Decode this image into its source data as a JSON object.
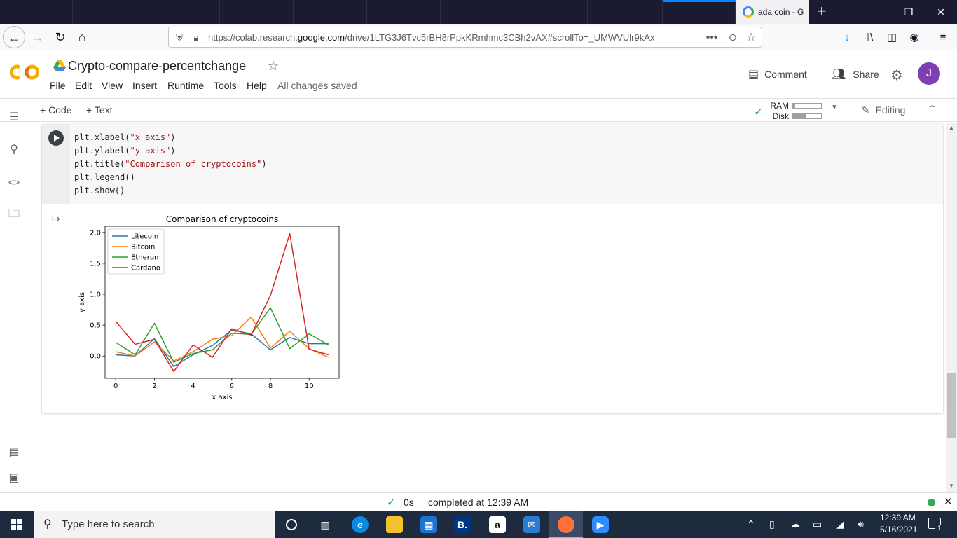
{
  "browser": {
    "active_tab_title": "ada coin - G",
    "url_prefix": "https://colab.research.",
    "url_domain": "google.com",
    "url_path": "/drive/1LTG3J6Tvc5rBH8rPpkKRmhmc3CBh2vAX#scrollTo=_UMWVUlr9kAx",
    "window_controls": {
      "minimize": "—",
      "restore": "❐",
      "close": "✕"
    },
    "new_tab": "+"
  },
  "colab": {
    "logo_text": "CO",
    "doc_title": "Crypto-compare-percentchange",
    "menu": [
      "File",
      "Edit",
      "View",
      "Insert",
      "Runtime",
      "Tools",
      "Help"
    ],
    "save_status": "All changes saved",
    "comment_label": "Comment",
    "share_label": "Share",
    "avatar_letter": "J",
    "toolbar": {
      "add_code": "+ Code",
      "add_text": "+ Text",
      "editing": "Editing"
    },
    "resources": {
      "ram_label": "RAM",
      "disk_label": "Disk",
      "ram_usage": 0.08,
      "disk_usage": 0.45
    }
  },
  "cell": {
    "code_lines": [
      [
        "plt.xlabel(",
        "\"x axis\"",
        ")"
      ],
      [
        "plt.ylabel(",
        "\"y axis\"",
        ")"
      ],
      [
        "plt.title(",
        "\"Comparison of cryptocoins\"",
        ")"
      ],
      [
        "plt.legend()",
        "",
        ""
      ],
      [
        "plt.show()",
        "",
        ""
      ]
    ]
  },
  "chart_data": {
    "type": "line",
    "title": "Comparison of cryptocoins",
    "xlabel": "x axis",
    "ylabel": "y axis",
    "x": [
      0,
      1,
      2,
      3,
      4,
      5,
      6,
      7,
      8,
      9,
      10,
      11
    ],
    "xlim": [
      -0.55,
      11.55
    ],
    "ylim": [
      -0.36,
      2.1
    ],
    "xticks": [
      0,
      2,
      4,
      6,
      8,
      10
    ],
    "yticks": [
      0.0,
      0.5,
      1.0,
      1.5,
      2.0
    ],
    "xtick_labels": [
      "0",
      "2",
      "4",
      "6",
      "8",
      "10"
    ],
    "ytick_labels": [
      "0.0",
      "0.5",
      "1.0",
      "1.5",
      "2.0"
    ],
    "legend_position": "upper-left",
    "grid": false,
    "series": [
      {
        "name": "Litecoin",
        "color": "#1f77b4",
        "values": [
          0.02,
          0.0,
          0.28,
          -0.17,
          0.02,
          0.17,
          0.42,
          0.36,
          0.1,
          0.3,
          0.2,
          0.2
        ]
      },
      {
        "name": "Bitcoin",
        "color": "#ff7f0e",
        "values": [
          0.07,
          0.0,
          0.23,
          -0.08,
          0.07,
          0.27,
          0.33,
          0.63,
          0.13,
          0.4,
          0.12,
          -0.02
        ]
      },
      {
        "name": "Etherum",
        "color": "#2ca02c",
        "values": [
          0.22,
          0.02,
          0.53,
          -0.1,
          0.04,
          0.1,
          0.37,
          0.35,
          0.78,
          0.12,
          0.36,
          0.18
        ]
      },
      {
        "name": "Cardano",
        "color": "#d62728",
        "values": [
          0.56,
          0.19,
          0.27,
          -0.25,
          0.18,
          -0.02,
          0.44,
          0.34,
          0.98,
          1.98,
          0.11,
          0.02
        ]
      }
    ]
  },
  "status": {
    "duration": "0s",
    "completed": "completed at 12:39 AM"
  },
  "taskbar": {
    "search_placeholder": "Type here to search",
    "time": "12:39 AM",
    "date": "5/16/2021",
    "notification_count": "1"
  },
  "icons": {
    "back": "back-arrow-icon",
    "forward": "forward-arrow-icon",
    "reload": "reload-icon",
    "home": "home-icon",
    "shield": "shield-icon",
    "lock": "lock-icon",
    "more": "more-dots-icon",
    "pocket": "pocket-icon",
    "bookmark": "star-icon",
    "download": "download-icon",
    "library": "library-icon",
    "sidebar": "sidebar-icon",
    "account": "account-icon",
    "hamburger": "hamburger-menu-icon"
  }
}
